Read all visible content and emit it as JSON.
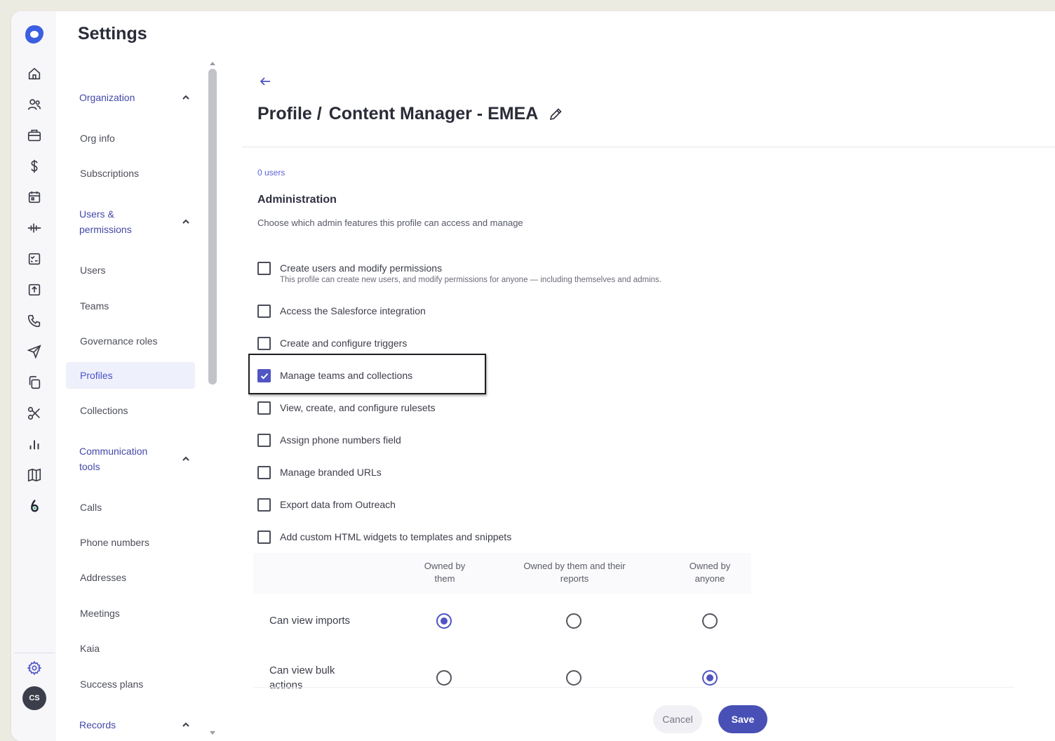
{
  "app": {
    "title": "Settings",
    "accent": "#4f55c2"
  },
  "rail": {
    "icons": [
      "home-icon",
      "users-icon",
      "briefcase-icon",
      "dollar-icon",
      "calendar-icon",
      "activity-icon",
      "checklist-icon",
      "upload-icon",
      "phone-icon",
      "send-icon",
      "copy-icon",
      "scissors-icon",
      "bar-chart-icon",
      "map-icon",
      "kaia-icon"
    ],
    "settings_icon": "gear-icon",
    "avatar_initials": "CS"
  },
  "nav": {
    "groups": {
      "organization": "Organization",
      "users_permissions_1": "Users &",
      "users_permissions_2": "permissions",
      "communication_1": "Communication",
      "communication_2": "tools",
      "records": "Records"
    },
    "items": {
      "org_info": "Org info",
      "subscriptions": "Subscriptions",
      "users": "Users",
      "teams": "Teams",
      "governance_roles": "Governance roles",
      "profiles": "Profiles",
      "collections": "Collections",
      "calls": "Calls",
      "phone_numbers": "Phone numbers",
      "addresses": "Addresses",
      "meetings": "Meetings",
      "kaia": "Kaia",
      "success_plans": "Success plans"
    }
  },
  "page": {
    "breadcrumb_parent": "Profile /",
    "breadcrumb_current": "Content Manager - EMEA",
    "users_link": "0 users",
    "section_title": "Administration",
    "section_desc": "Choose which admin features this profile can access and manage"
  },
  "permissions": [
    {
      "label": "Create users and modify permissions",
      "sub": "This profile can create new users, and modify permissions for anyone — including themselves and admins.",
      "checked": false
    },
    {
      "label": "Access the Salesforce integration",
      "checked": false
    },
    {
      "label": "Create and configure triggers",
      "checked": false
    },
    {
      "label": "Manage teams and collections",
      "checked": true
    },
    {
      "label": "View, create, and configure rulesets",
      "checked": false
    },
    {
      "label": "Assign phone numbers field",
      "checked": false
    },
    {
      "label": "Manage branded URLs",
      "checked": false
    },
    {
      "label": "Export data from Outreach",
      "checked": false
    },
    {
      "label": "Add custom HTML widgets to templates and snippets",
      "checked": false
    }
  ],
  "ownership_table": {
    "columns": [
      {
        "l1": "Owned by",
        "l2": "them"
      },
      {
        "l1": "Owned by them and their",
        "l2": "reports"
      },
      {
        "l1": "Owned by",
        "l2": "anyone"
      }
    ],
    "rows": [
      {
        "l1": "Can view imports",
        "l2": "",
        "selected": "Owned by them"
      },
      {
        "l1": "Can view bulk",
        "l2": "actions",
        "selected": "Owned by anyone"
      }
    ]
  },
  "footer": {
    "cancel": "Cancel",
    "save": "Save"
  }
}
